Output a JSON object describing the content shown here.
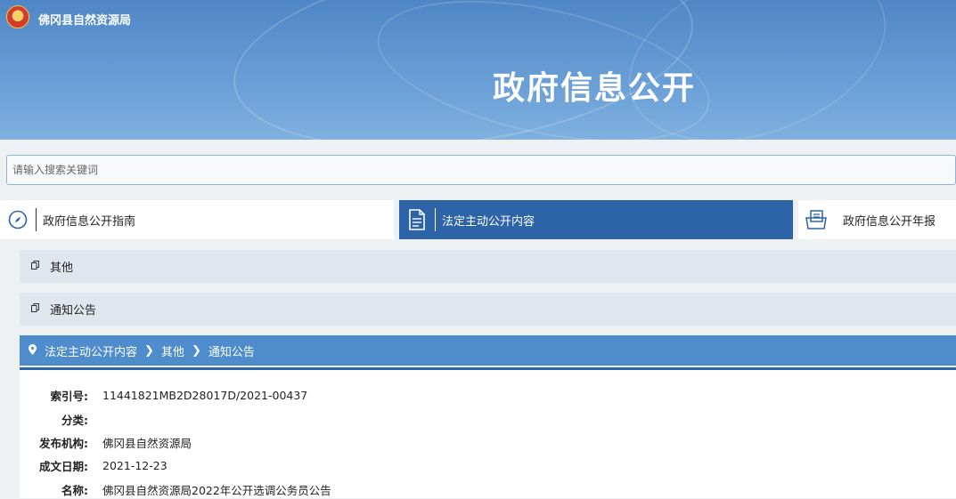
{
  "header": {
    "site_name": "佛冈县自然资源局",
    "banner_title": "政府信息公开"
  },
  "search": {
    "placeholder": "请输入搜索关键词"
  },
  "tabs": [
    {
      "label": "政府信息公开指南",
      "icon": "compass-icon"
    },
    {
      "label": "法定主动公开内容",
      "icon": "document-icon"
    },
    {
      "label": "政府信息公开年报",
      "icon": "report-icon"
    }
  ],
  "categories": [
    {
      "label": "其他"
    },
    {
      "label": "通知公告"
    }
  ],
  "breadcrumb": [
    "法定主动公开内容",
    "其他",
    "通知公告"
  ],
  "info": {
    "index_label": "索引号:",
    "index_value": "11441821MB2D28017D/2021-00437",
    "category_label": "分类:",
    "category_value": "",
    "publisher_label": "发布机构:",
    "publisher_value": "佛冈县自然资源局",
    "date_label": "成文日期:",
    "date_value": "2021-12-23",
    "name_label": "名称:",
    "name_value": "佛冈县自然资源局2022年公开选调公务员公告"
  },
  "colors": {
    "active_tab": "#2d63a7",
    "breadcrumb_bar": "#4e8ccb",
    "category_bar": "#dfe6ee"
  }
}
